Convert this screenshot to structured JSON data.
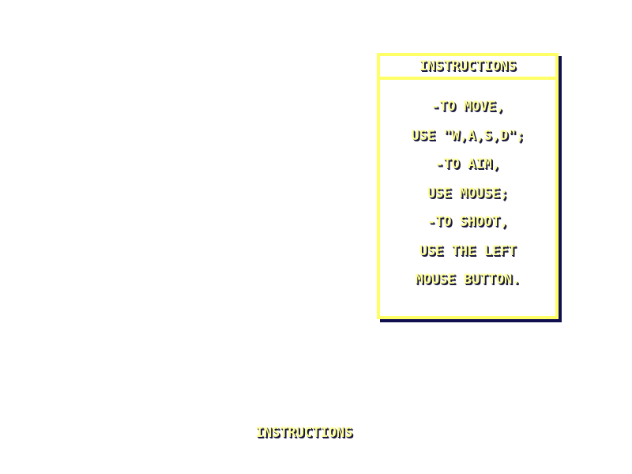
{
  "panel": {
    "title": "INSTRUCTIONS",
    "lines": [
      "-TO MOVE,",
      "USE \"W,A,S,D\";",
      "-TO AIM,",
      "USE MOUSE;",
      "-TO SHOOT,",
      "USE THE LEFT",
      "MOUSE BUTTON."
    ]
  },
  "footer": {
    "label": "INSTRUCTIONS"
  },
  "colors": {
    "text": "#ffff99",
    "text_shadow": "#1a1a40",
    "panel_border": "#ffff66",
    "panel_shadow": "#101050",
    "background": "#ffffff"
  }
}
